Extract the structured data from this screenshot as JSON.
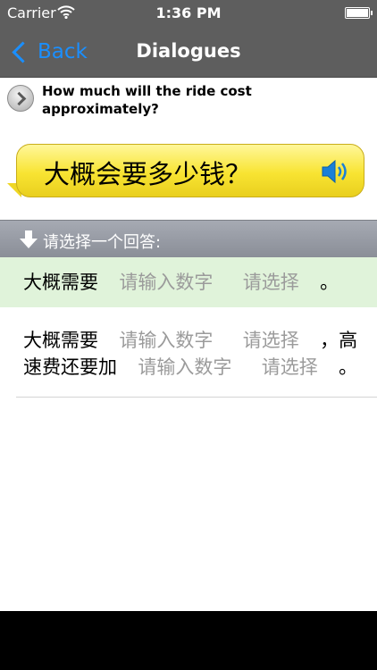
{
  "status_bar": {
    "carrier": "Carrier",
    "time": "1:36 PM",
    "battery_level": 1.0
  },
  "nav": {
    "back_label": "Back",
    "title": "Dialogues"
  },
  "question": {
    "english": "How much will the ride cost approximately?",
    "icon": "chevron-right-circle-icon"
  },
  "bubble": {
    "chinese": "大概会要多少钱？",
    "icon": "speaker-icon"
  },
  "prompt": {
    "text": "请选择一个回答:",
    "icon": "down-arrow-icon"
  },
  "answers": [
    {
      "part1": "大概需要",
      "input_placeholder": "请输入数字",
      "select_placeholder": "请选择",
      "ending": "。"
    },
    {
      "line1_text": "大概需要",
      "line1_input_placeholder": "请输入数字",
      "line1_select_placeholder": "请选择",
      "line1_ending": "，高",
      "line2_text": "速费还要加",
      "line2_input_placeholder": "请输入数字",
      "line2_select_placeholder": "请选择",
      "line2_ending": "。"
    }
  ],
  "colors": {
    "nav_background": "#5e5e5e",
    "accent_blue": "#1a8fff",
    "bubble_yellow": "#f8e432",
    "selected_row": "#e0f3da",
    "placeholder_gray": "#9b9b9b"
  }
}
